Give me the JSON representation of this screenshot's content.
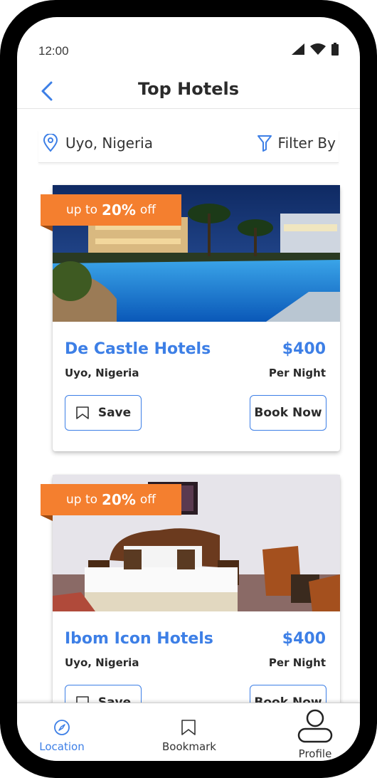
{
  "status_bar": {
    "time": "12:00"
  },
  "header": {
    "title": "Top Hotels"
  },
  "location_bar": {
    "location": "Uyo, Nigeria",
    "filter_label": "Filter By"
  },
  "hotels": [
    {
      "discount_prefix": "up to",
      "discount_value": "20%",
      "discount_suffix": "off",
      "name": "De Castle Hotels",
      "price": "$400",
      "location": "Uyo, Nigeria",
      "price_unit": "Per Night",
      "save_label": "Save",
      "book_label": "Book Now"
    },
    {
      "discount_prefix": "up to",
      "discount_value": "20%",
      "discount_suffix": "off",
      "name": "Ibom Icon Hotels",
      "price": "$400",
      "location": "Uyo, Nigeria",
      "price_unit": "Per Night",
      "save_label": "Save",
      "book_label": "Book Now"
    }
  ],
  "tab_bar": {
    "items": [
      {
        "label": "Location",
        "icon": "compass-icon",
        "active": true
      },
      {
        "label": "Bookmark",
        "icon": "bookmark-icon",
        "active": false
      },
      {
        "label": "Profile",
        "icon": "user-icon",
        "active": false
      }
    ]
  },
  "colors": {
    "accent": "#3d7fe6",
    "badge": "#f47f2f",
    "frame": "#000000"
  }
}
